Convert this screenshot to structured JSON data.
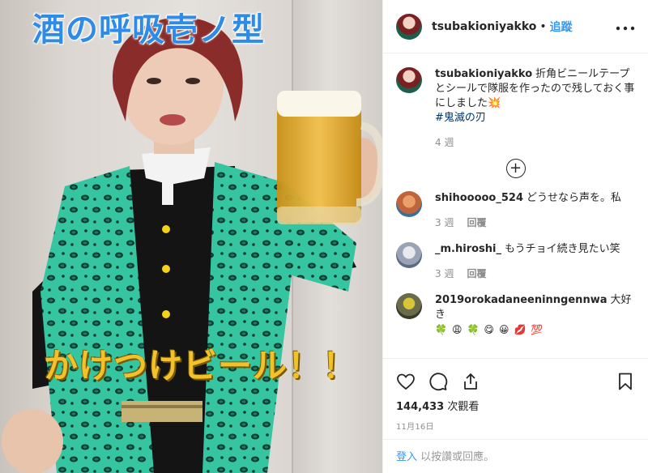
{
  "media": {
    "overlay_title": "酒の呼吸壱ノ型",
    "overlay_caption": "かけつけビール！！"
  },
  "header": {
    "username": "tsubakioniyakko",
    "separator": "•",
    "follow_label": "追蹤",
    "more_icon": "more-horizontal-icon"
  },
  "caption": {
    "username": "tsubakioniyakko",
    "text": "折角ビニールテープとシールで隊服を作ったので残しておく事にしました",
    "emoji": "💥",
    "hashtag": "#鬼滅の刃",
    "time": "4 週"
  },
  "comments": [
    {
      "username": "shihooooo_524",
      "text": "どうせなら声を。私",
      "time": "3 週",
      "reply": "回覆",
      "avatar_color": "#c0643c"
    },
    {
      "username": "_m.hiroshi_",
      "text": "もうチョイ続き見たい笑",
      "time": "3 週",
      "reply": "回覆",
      "avatar_color": "#9aa3b5"
    },
    {
      "username": "2019orokadaneeninngennwa",
      "text": "大好き",
      "emojis": [
        "🍀",
        "😩",
        "🍀",
        "😋",
        "😀",
        "💋",
        "💯"
      ],
      "avatar_color": "#6b6b4a"
    }
  ],
  "actions": {
    "like_icon": "heart-icon",
    "comment_icon": "comment-icon",
    "share_icon": "share-icon",
    "save_icon": "bookmark-icon",
    "views_count": "144,433",
    "views_label": "次觀看",
    "date": "11月16日"
  },
  "login": {
    "link_text": "登入",
    "text": "以按讚或回應。"
  },
  "colors": {
    "link": "#3897f0",
    "hashtag": "#003569",
    "muted": "#8e8e8e",
    "title_blue": "#2e8be8",
    "caption_yellow": "#f3c22b"
  }
}
